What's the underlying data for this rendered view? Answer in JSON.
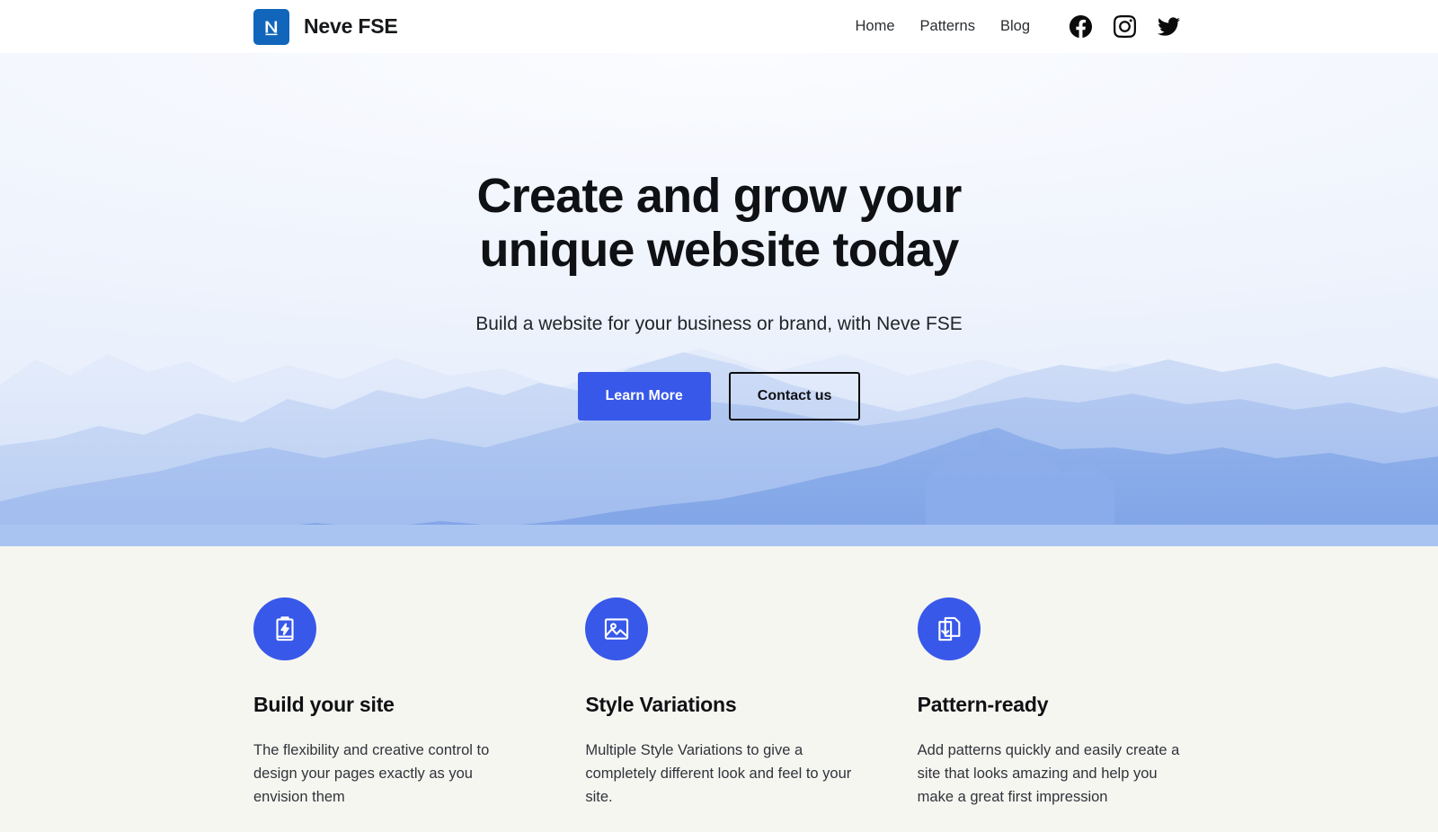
{
  "theme": {
    "accent_blue": "#3858e9",
    "logo_blue": "#1166bb",
    "features_bg": "#f6f6f1",
    "hero_bg": "#eef3fc",
    "text_dark": "#101114"
  },
  "header": {
    "brand": {
      "logo_icon": "neve-n-logo-icon",
      "name": "Neve FSE"
    },
    "nav_items": [
      {
        "label": "Home"
      },
      {
        "label": "Patterns"
      },
      {
        "label": "Blog"
      }
    ],
    "social_links": [
      {
        "name": "facebook",
        "icon": "facebook-icon"
      },
      {
        "name": "instagram",
        "icon": "instagram-icon"
      },
      {
        "name": "twitter",
        "icon": "twitter-icon"
      }
    ]
  },
  "hero": {
    "title_line_1": "Create and grow your",
    "title_line_2": "unique website today",
    "subtitle": "Build a website for your business or brand, with Neve FSE",
    "primary_button": "Learn More",
    "secondary_button": "Contact us",
    "background_image": "blue-mountain-range-silhouette"
  },
  "features": [
    {
      "icon": "battery-lightning-icon",
      "title": "Build your site",
      "text": "The flexibility and creative control to design your pages exactly as you envision them"
    },
    {
      "icon": "image-picture-icon",
      "title": "Style Variations",
      "text": "Multiple Style Variations to give a completely different look and feel to your site."
    },
    {
      "icon": "documents-download-icon",
      "title": "Pattern-ready",
      "text": "Add patterns quickly and easily create a site that looks amazing and help you make a great first impression"
    }
  ]
}
